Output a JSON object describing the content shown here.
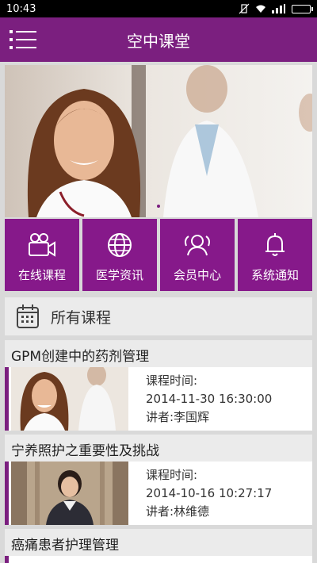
{
  "status_bar": {
    "time": "10:43"
  },
  "app_bar": {
    "title": "空中课堂"
  },
  "tiles": [
    {
      "label": "在线课程",
      "icon": "video-camera-icon"
    },
    {
      "label": "医学资讯",
      "icon": "globe-icon"
    },
    {
      "label": "会员中心",
      "icon": "members-icon"
    },
    {
      "label": "系统通知",
      "icon": "bell-icon"
    }
  ],
  "section": {
    "label": "所有课程",
    "icon": "calendar-icon"
  },
  "courses": [
    {
      "title": "GPM创建中的药剂管理",
      "time_label": "课程时间:",
      "time": "2014-11-30 16:30:00",
      "lecturer": "讲者:李国辉"
    },
    {
      "title": "宁养照护之重要性及挑战",
      "time_label": "课程时间:",
      "time": "2014-10-16 10:27:17",
      "lecturer": "讲者:林维德"
    },
    {
      "title": "癌痛患者护理管理"
    }
  ],
  "colors": {
    "brand": "#7b1f7f",
    "tile": "#86198a",
    "background": "#d9d9d9"
  }
}
